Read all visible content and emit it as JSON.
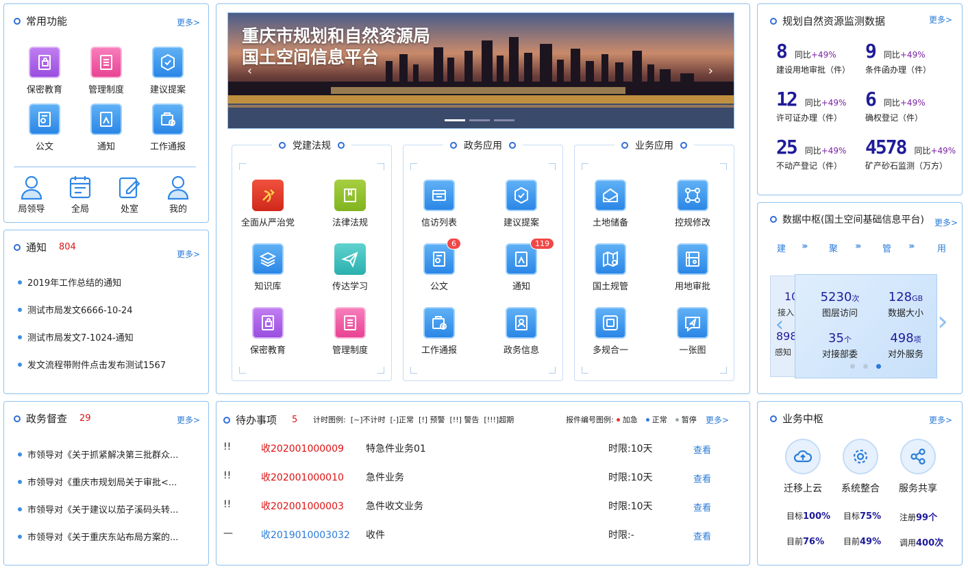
{
  "common": {
    "title": "常用功能",
    "more": "更多>",
    "tiles": [
      {
        "label": "保密教育",
        "icon": "secret-education-icon"
      },
      {
        "label": "管理制度",
        "icon": "management-system-icon"
      },
      {
        "label": "建议提案",
        "icon": "suggestion-icon"
      },
      {
        "label": "公文",
        "icon": "document-icon"
      },
      {
        "label": "通知",
        "icon": "notice-icon"
      },
      {
        "label": "工作通报",
        "icon": "work-report-icon"
      }
    ],
    "persons": [
      {
        "label": "局领导",
        "icon": "leader-icon"
      },
      {
        "label": "全局",
        "icon": "calendar-icon"
      },
      {
        "label": "处室",
        "icon": "edit-icon"
      },
      {
        "label": "我的",
        "icon": "user-icon"
      }
    ]
  },
  "notice": {
    "title": "通知",
    "count": "804",
    "more": "更多>",
    "items": [
      "2019年工作总结的通知",
      "测试市局发文6666-10-24",
      "测试市局发文7-1024-通知",
      "发文流程带附件点击发布测试1567"
    ]
  },
  "supervision": {
    "title": "政务督查",
    "count": "29",
    "more": "更多>",
    "items": [
      "市领导对《关于抓紧解决第三批群众...",
      "市领导对《重庆市规划局关于审批<...",
      "市领导对《关于建议以茄子溪码头转...",
      "市领导对《关于重庆东站布局方案的..."
    ]
  },
  "banner": {
    "line1": "重庆市规划和自然资源局",
    "line2": "国土空间信息平台"
  },
  "apps": [
    {
      "title": "党建法规",
      "items": [
        {
          "label": "全面从严治党",
          "icon": "party-icon"
        },
        {
          "label": "法律法规",
          "icon": "law-book-icon"
        },
        {
          "label": "知识库",
          "icon": "knowledge-base-icon"
        },
        {
          "label": "传达学习",
          "icon": "paper-plane-icon"
        },
        {
          "label": "保密教育",
          "icon": "secret-education-icon"
        },
        {
          "label": "管理制度",
          "icon": "management-system-icon"
        }
      ]
    },
    {
      "title": "政务应用",
      "items": [
        {
          "label": "信访列表",
          "icon": "petition-icon",
          "badge": ""
        },
        {
          "label": "建议提案",
          "icon": "suggestion-icon",
          "badge": ""
        },
        {
          "label": "公文",
          "icon": "document-icon",
          "badge": "6"
        },
        {
          "label": "通知",
          "icon": "notice-icon",
          "badge": "119"
        },
        {
          "label": "工作通报",
          "icon": "work-report-icon",
          "badge": ""
        },
        {
          "label": "政务信息",
          "icon": "gov-info-icon",
          "badge": ""
        }
      ]
    },
    {
      "title": "业务应用",
      "items": [
        {
          "label": "土地储备",
          "icon": "land-reserve-icon"
        },
        {
          "label": "控规修改",
          "icon": "flow-icon"
        },
        {
          "label": "国土规管",
          "icon": "map-gear-icon"
        },
        {
          "label": "用地审批",
          "icon": "land-approval-icon"
        },
        {
          "label": "多规合一",
          "icon": "layers-icon"
        },
        {
          "label": "一张图",
          "icon": "map-icon"
        }
      ]
    }
  ],
  "todo": {
    "title": "待办事项",
    "count": "5",
    "legend_time": "计时图例:  [~]不计时  [-]正常  [!] 预警  [!!] 警告  [!!!]超期",
    "legend_code": "报件编号图例:",
    "legend_urgent": "加急",
    "legend_normal": "正常",
    "legend_pause": "暂停",
    "more": "更多>",
    "rows": [
      {
        "mark": "!!",
        "code": "收202001000009",
        "name": "特急件业务01",
        "limit": "时限:10天",
        "view": "查看",
        "urgent": true
      },
      {
        "mark": "!!",
        "code": "收202001000010",
        "name": "急件业务",
        "limit": "时限:10天",
        "view": "查看",
        "urgent": true
      },
      {
        "mark": "!!",
        "code": "收202001000003",
        "name": "急件收文业务",
        "limit": "时限:10天",
        "view": "查看",
        "urgent": true
      },
      {
        "mark": "—",
        "code": "收2019010003032",
        "name": "收件",
        "limit": "时限:-",
        "view": "查看",
        "urgent": false
      }
    ]
  },
  "monitor": {
    "title": "规划自然资源监测数据",
    "more": "更多>",
    "stats": [
      {
        "num": "8",
        "yoy_label": "同比",
        "yoy": "+49%",
        "label": "建设用地审批（件）"
      },
      {
        "num": "9",
        "yoy_label": "同比",
        "yoy": "+49%",
        "label": "条件函办理（件）"
      },
      {
        "num": "12",
        "yoy_label": "同比",
        "yoy": "+49%",
        "label": "许可证办理（件）"
      },
      {
        "num": "6",
        "yoy_label": "同比",
        "yoy": "+49%",
        "label": "确权登记（件）"
      },
      {
        "num": "25",
        "yoy_label": "同比",
        "yoy": "+49%",
        "label": "不动产登记（件）"
      },
      {
        "num": "4578",
        "yoy_label": "同比",
        "yoy": "+49%",
        "label": "矿产砂石监测（万方）"
      }
    ]
  },
  "datahub": {
    "title": "数据中枢(国土空间基础信息平台)",
    "more": "更多>",
    "steps": [
      "建",
      "聚",
      "管",
      "用"
    ],
    "card": [
      {
        "num": "5230",
        "unit": "次",
        "label": "图层访问"
      },
      {
        "num": "128",
        "unit": "GB",
        "label": "数据大小"
      },
      {
        "num": "35",
        "unit": "个",
        "label": "对接部委"
      },
      {
        "num": "498",
        "unit": "项",
        "label": "对外服务"
      }
    ],
    "back_card": [
      "10",
      "接入",
      "898",
      "感知"
    ]
  },
  "business": {
    "title": "业务中枢",
    "more": "更多>",
    "items": [
      {
        "label": "迁移上云",
        "icon": "cloud-upload-icon",
        "l1": "目标",
        "v1": "100%",
        "l2": "目前",
        "v2": "76%"
      },
      {
        "label": "系统整合",
        "icon": "gear-icon",
        "l1": "目标",
        "v1": "75%",
        "l2": "目前",
        "v2": "49%"
      },
      {
        "label": "服务共享",
        "icon": "share-icon",
        "l1": "注册",
        "v1": "99个",
        "l2": "调用",
        "v2": "400次"
      }
    ]
  },
  "colors": {
    "accent": "#2a7bd8",
    "border": "#8fc1ef",
    "urgent": "#d11",
    "number": "#1f1b99"
  }
}
